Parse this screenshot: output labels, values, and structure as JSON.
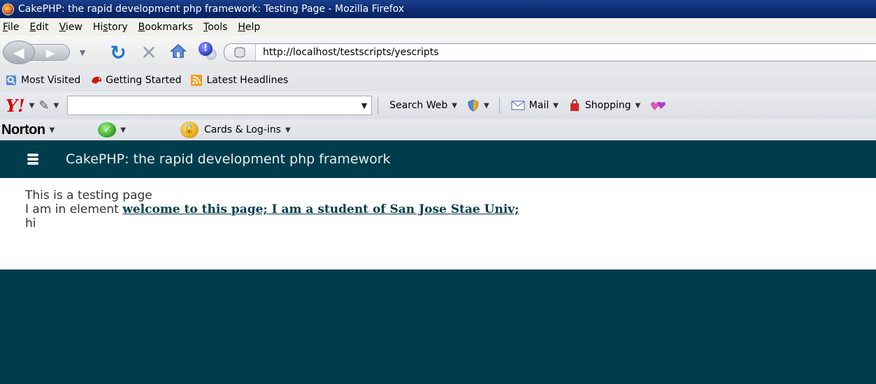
{
  "window": {
    "title": "CakePHP: the rapid development php framework: Testing Page - Mozilla Firefox"
  },
  "menu": {
    "items": [
      {
        "first": "F",
        "rest": "ile"
      },
      {
        "first": "E",
        "rest": "dit"
      },
      {
        "first": "V",
        "rest": "iew"
      },
      {
        "pre": "Hi",
        "first": "s",
        "rest": "tory"
      },
      {
        "first": "B",
        "rest": "ookmarks"
      },
      {
        "first": "T",
        "rest": "ools"
      },
      {
        "first": "H",
        "rest": "elp"
      }
    ]
  },
  "navbar": {
    "url": "http://localhost/testscripts/yescripts"
  },
  "bookmarks": {
    "items": [
      {
        "label": "Most Visited",
        "icon": "most-visited-icon"
      },
      {
        "label": "Getting Started",
        "icon": "getting-started-icon"
      },
      {
        "label": "Latest Headlines",
        "icon": "rss-feed-icon"
      }
    ]
  },
  "yahoo_toolbar": {
    "logo": "Y!",
    "search_label": "Search Web",
    "mail_label": "Mail",
    "shopping_label": "Shopping"
  },
  "norton_toolbar": {
    "logo": "Norton",
    "cards_label": "Cards & Log-ins"
  },
  "page": {
    "header_title": "CakePHP: the rapid development php framework",
    "line1": "This is a testing page",
    "line2_prefix": "I am in element ",
    "line2_link": "welcome to this page; I am a student of San Jose Stae Univ;",
    "line3": "hi",
    "accent_color": "#003d4c"
  }
}
